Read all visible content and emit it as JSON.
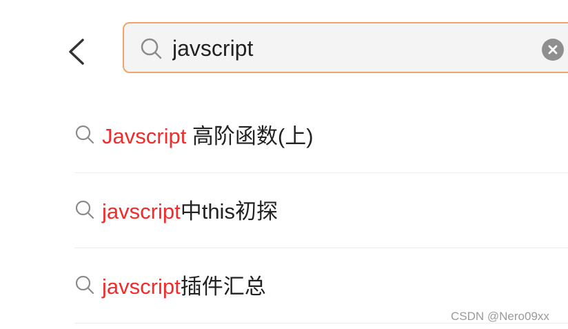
{
  "search": {
    "value": "javscript",
    "placeholder": ""
  },
  "results": [
    {
      "highlight": "Javscript",
      "rest": " 高阶函数(上)"
    },
    {
      "highlight": "javscript",
      "rest": "中this初探"
    },
    {
      "highlight": "javscript",
      "rest": "插件汇总"
    }
  ],
  "watermark": "CSDN @Nero09xx",
  "colors": {
    "accent_border": "#f4a26b",
    "highlight": "#f22b2b",
    "clear_button": "#8f8f8f"
  },
  "icons": {
    "back": "chevron-left-icon",
    "search": "search-icon",
    "clear": "clear-icon"
  }
}
